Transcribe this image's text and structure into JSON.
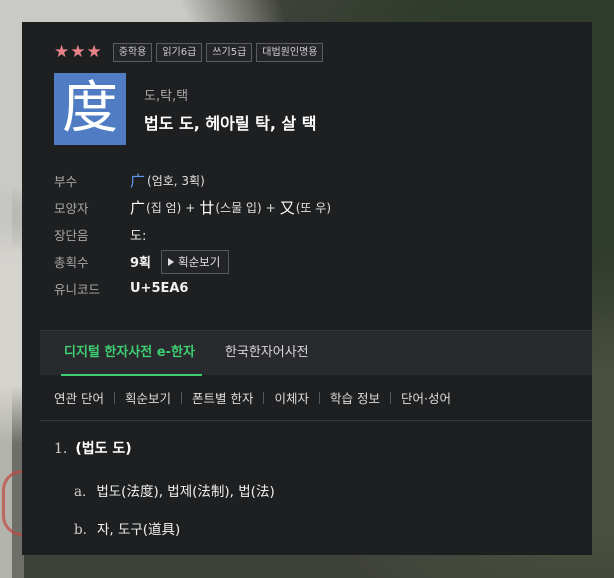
{
  "entry": {
    "stars": "★★★",
    "badges": [
      "중학용",
      "읽기6급",
      "쓰기5급",
      "대법원인명용"
    ],
    "hanja": "度",
    "reading": "도,탁,택",
    "meaning": "법도 도, 헤아릴 탁, 살 택"
  },
  "props": {
    "radical": {
      "label": "부수",
      "char": "广",
      "text": "(엄호, 3획)"
    },
    "shape": {
      "label": "모양자",
      "parts": [
        {
          "char": "广",
          "text": "(집 엄)"
        },
        {
          "char": "廿",
          "text": "(스물 입)"
        },
        {
          "char": "又",
          "text": "(또 우)"
        }
      ],
      "plus": "+"
    },
    "long_short": {
      "label": "장단음",
      "value": "도:"
    },
    "strokes": {
      "label": "총획수",
      "value": "9획",
      "button": "획순보기"
    },
    "unicode": {
      "label": "유니코드",
      "value": "U+5EA6"
    }
  },
  "tabs": [
    "디지털 한자사전 e-한자",
    "한국한자어사전"
  ],
  "subnav": [
    "연관 단어",
    "획순보기",
    "폰트별 한자",
    "이체자",
    "학습 정보",
    "단어·성어"
  ],
  "definitions": {
    "main": {
      "num": "1.",
      "text": "(법도 도)"
    },
    "subs": [
      {
        "letter": "a.",
        "text": "법도(法度), 법제(法制), 법(法)"
      },
      {
        "letter": "b.",
        "text": "자, 도구(道具)"
      }
    ]
  },
  "colors": {
    "accent": "#3ecf73",
    "hanja_box": "#4f7cc2",
    "radical": "#5b9bf0",
    "stars": "#e8838a"
  }
}
